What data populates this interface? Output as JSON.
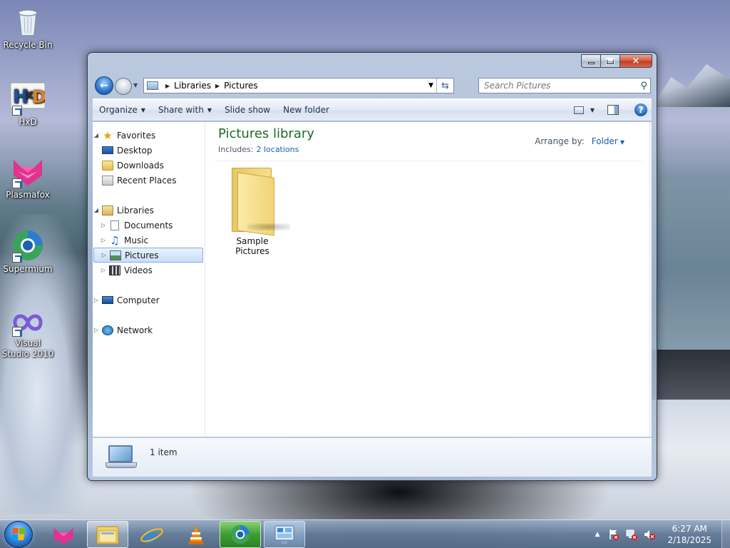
{
  "desktop": {
    "icons": [
      {
        "label": "Recycle Bin",
        "icon": "recycle-bin-icon"
      },
      {
        "label": "HxD",
        "icon": "hxd-icon"
      },
      {
        "label": "Plasmafox",
        "icon": "plasmafox-icon"
      },
      {
        "label": "Supermium",
        "icon": "supermium-icon"
      },
      {
        "label": "Visual Studio 2010",
        "icon": "visual-studio-icon"
      }
    ]
  },
  "window": {
    "caption_buttons": {
      "minimize": "minimize-icon",
      "maximize": "maximize-icon",
      "close": "×"
    },
    "address": {
      "crumbs": [
        "Libraries",
        "Pictures"
      ]
    },
    "search": {
      "placeholder": "Search Pictures"
    },
    "toolbar": {
      "organize": "Organize",
      "share_with": "Share with",
      "slide_show": "Slide show",
      "new_folder": "New folder",
      "help": "?"
    },
    "nav_tree": {
      "favorites": {
        "label": "Favorites",
        "items": [
          "Desktop",
          "Downloads",
          "Recent Places"
        ]
      },
      "libraries": {
        "label": "Libraries",
        "items": [
          "Documents",
          "Music",
          "Pictures",
          "Videos"
        ]
      },
      "computer": "Computer",
      "network": "Network"
    },
    "library": {
      "title": "Pictures library",
      "includes_label": "Includes:",
      "includes_link": "2 locations",
      "arrange_label": "Arrange by:",
      "arrange_value": "Folder"
    },
    "items": [
      {
        "label": "Sample Pictures",
        "icon": "folder-icon"
      }
    ],
    "status": {
      "item_count": "1 item"
    }
  },
  "taskbar": {
    "apps": [
      {
        "name": "plasmafox",
        "icon": "plasmafox-icon"
      },
      {
        "name": "windows-explorer",
        "icon": "explorer-icon"
      },
      {
        "name": "internet-explorer",
        "icon": "ie-icon"
      },
      {
        "name": "vlc",
        "icon": "vlc-icon"
      },
      {
        "name": "supermium",
        "icon": "supermium-icon"
      },
      {
        "name": "control-panel",
        "icon": "control-panel-icon"
      }
    ],
    "clock": {
      "time": "6:27 AM",
      "date": "2/18/2025"
    }
  },
  "colors": {
    "library_title": "#1e6a2e",
    "link": "#1a5fb4",
    "selection": "#c9def7"
  }
}
